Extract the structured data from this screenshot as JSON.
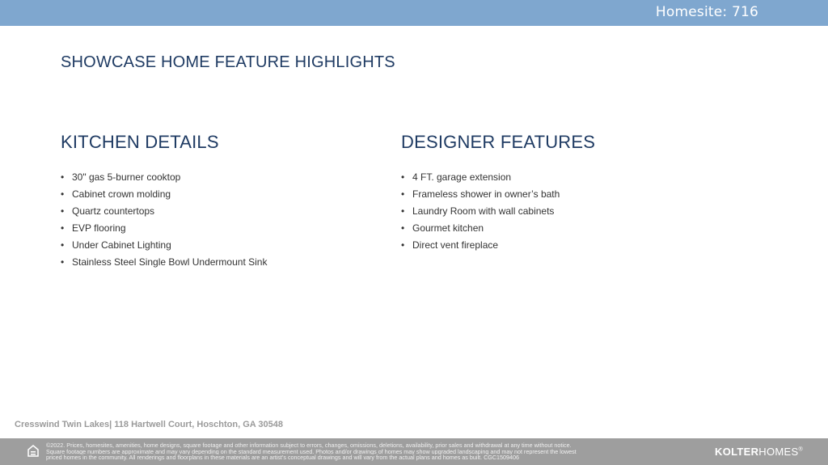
{
  "header": {
    "homesite": "Homesite: 716",
    "bar_color": "#7fa7cf"
  },
  "page": {
    "title": "SHOWCASE HOME FEATURE HIGHLIGHTS",
    "title_color": "#1f3b63"
  },
  "kitchen": {
    "heading": "KITCHEN DETAILS",
    "items": [
      "30\" gas 5-burner cooktop",
      "Cabinet crown molding",
      "Quartz countertops",
      "EVP flooring",
      "Under Cabinet Lighting",
      "Stainless Steel Single Bowl Undermount Sink"
    ]
  },
  "designer": {
    "heading": "DESIGNER FEATURES",
    "items": [
      "4 FT. garage extension",
      "Frameless shower in owner’s bath",
      "Laundry Room with wall cabinets",
      "Gourmet kitchen",
      "Direct vent fireplace"
    ]
  },
  "footer": {
    "address": "Cresswind Twin Lakes| 118 Hartwell Court,  Hoschton, GA 30548",
    "disclaimer_line1": "©2022. Prices, homesites, amenities, home designs, square footage and other information subject to errors, changes, omissions, deletions, availability, prior sales and withdrawal at any time without notice.",
    "disclaimer_line2": "Square footage numbers are approximate and may vary depending on the standard measurement used. Photos and/or drawings of homes may show upgraded landscaping and may not represent the lowest",
    "disclaimer_line3": "priced homes in the community. All renderings and floorplans in these materials are an artist’s conceptual drawings and will vary from the actual plans and homes as built. CGC1509406",
    "brand_bold": "KOLTER",
    "brand_light": "HOMES",
    "brand_mark": "®",
    "icon": "equal-housing-icon",
    "bar_color": "#9e9e9e"
  }
}
